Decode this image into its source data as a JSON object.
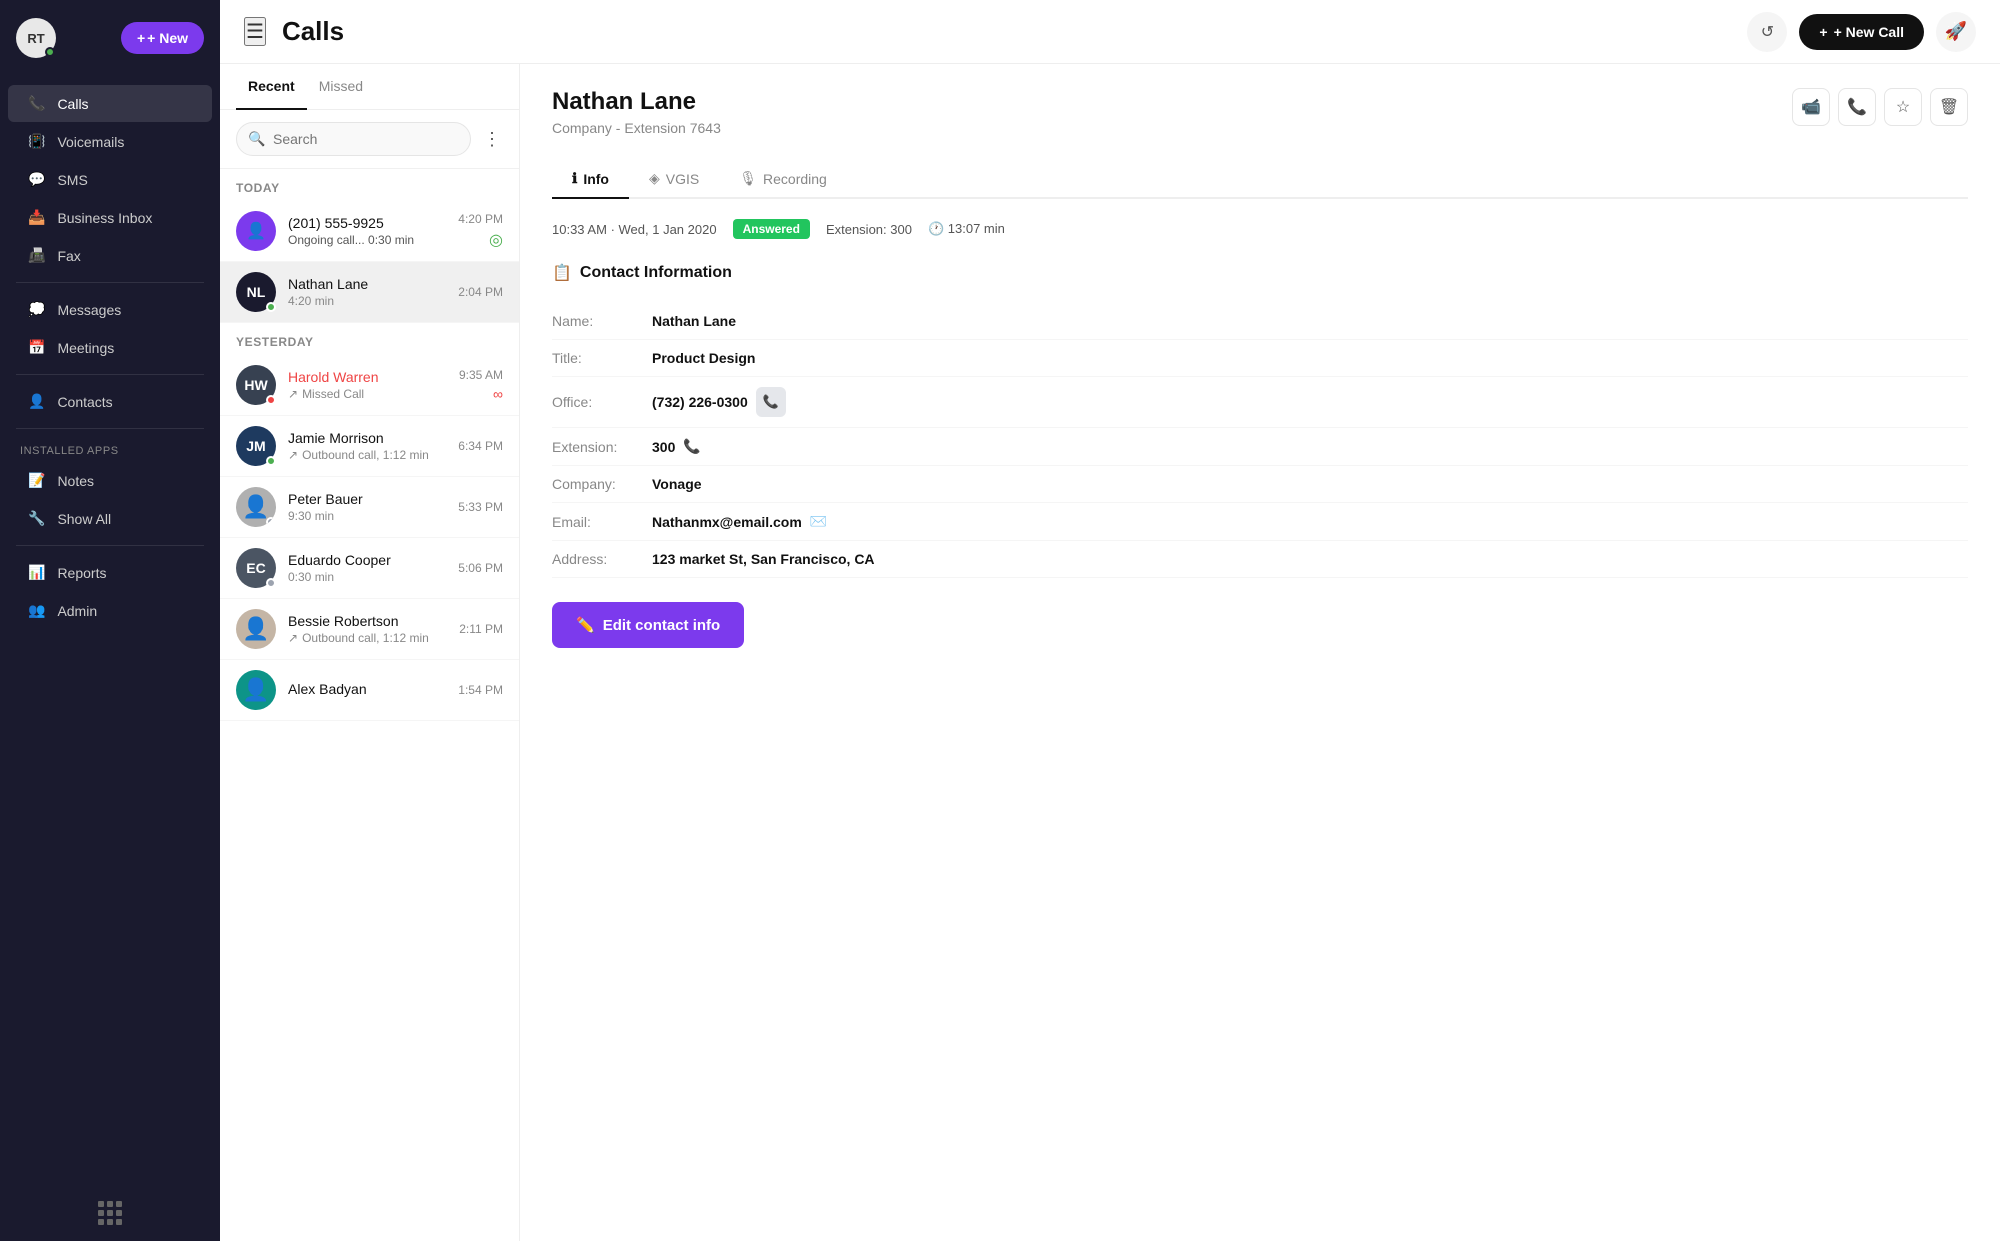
{
  "sidebar": {
    "avatar": "RT",
    "new_button": "+ New",
    "nav_items": [
      {
        "id": "calls",
        "label": "Calls",
        "active": true
      },
      {
        "id": "voicemails",
        "label": "Voicemails",
        "active": false
      },
      {
        "id": "sms",
        "label": "SMS",
        "active": false
      },
      {
        "id": "business-inbox",
        "label": "Business Inbox",
        "active": false
      },
      {
        "id": "fax",
        "label": "Fax",
        "active": false
      }
    ],
    "nav_items2": [
      {
        "id": "messages",
        "label": "Messages",
        "active": false
      },
      {
        "id": "meetings",
        "label": "Meetings",
        "active": false
      }
    ],
    "nav_items3": [
      {
        "id": "contacts",
        "label": "Contacts",
        "active": false
      }
    ],
    "installed_apps_label": "INSTALLED APPS",
    "installed_items": [
      {
        "id": "notes",
        "label": "Notes",
        "active": false
      },
      {
        "id": "show-all",
        "label": "Show All",
        "active": false
      }
    ],
    "bottom_items": [
      {
        "id": "reports",
        "label": "Reports",
        "active": false
      },
      {
        "id": "admin",
        "label": "Admin",
        "active": false
      }
    ]
  },
  "topbar": {
    "title": "Calls",
    "new_call_label": "+ New Call"
  },
  "calls_panel": {
    "tabs": [
      {
        "label": "Recent",
        "active": true
      },
      {
        "label": "Missed",
        "active": false
      }
    ],
    "search_placeholder": "Search",
    "sections": [
      {
        "label": "TODAY",
        "items": [
          {
            "id": "call-1",
            "name": "(201) 555-9925",
            "sub": "Ongoing call... 0:30 min",
            "time": "4:20 PM",
            "bg": "#7c3aed",
            "initials": "",
            "is_phone": true,
            "ongoing": true,
            "missed": false
          },
          {
            "id": "call-2",
            "name": "Nathan Lane",
            "sub": "4:20 min",
            "time": "2:04 PM",
            "bg": "#1a1a2e",
            "initials": "NL",
            "ongoing": false,
            "missed": false,
            "selected": true,
            "status": "green"
          }
        ]
      },
      {
        "label": "YESTERDAY",
        "items": [
          {
            "id": "call-3",
            "name": "Harold Warren",
            "sub": "Missed Call",
            "time": "9:35 AM",
            "bg": "#374151",
            "initials": "HW",
            "ongoing": false,
            "missed": true,
            "status": "red"
          },
          {
            "id": "call-4",
            "name": "Jamie Morrison",
            "sub": "Outbound call, 1:12 min",
            "time": "6:34 PM",
            "bg": "#1e3a5f",
            "initials": "JM",
            "ongoing": false,
            "missed": false,
            "status": "green",
            "outbound": true
          },
          {
            "id": "call-5",
            "name": "Peter Bauer",
            "sub": "9:30 min",
            "time": "5:33 PM",
            "bg": "#9ca3af",
            "initials": "",
            "has_photo": true,
            "ongoing": false,
            "missed": false,
            "status": "gray"
          },
          {
            "id": "call-6",
            "name": "Eduardo Cooper",
            "sub": "0:30 min",
            "time": "5:06 PM",
            "bg": "#374151",
            "initials": "EC",
            "ongoing": false,
            "missed": false,
            "status": "gray"
          },
          {
            "id": "call-7",
            "name": "Bessie Robertson",
            "sub": "Outbound call, 1:12 min",
            "time": "2:11 PM",
            "bg": "#9ca3af",
            "initials": "",
            "has_photo": true,
            "ongoing": false,
            "missed": false,
            "outbound": true
          },
          {
            "id": "call-8",
            "name": "Alex Badyan",
            "sub": "",
            "time": "1:54 PM",
            "bg": "#0d9488",
            "initials": "",
            "has_photo": true,
            "ongoing": false,
            "missed": false
          }
        ]
      }
    ]
  },
  "detail": {
    "name": "Nathan Lane",
    "sub": "Company  -  Extension 7643",
    "tabs": [
      {
        "label": "Info",
        "active": true,
        "icon": "ℹ️"
      },
      {
        "label": "VGIS",
        "active": false,
        "icon": "🔮"
      },
      {
        "label": "Recording",
        "active": false,
        "icon": "🎤"
      }
    ],
    "meta": {
      "time": "10:33 AM",
      "date": "Wed, 1 Jan 2020",
      "status": "Answered",
      "extension_label": "Extension:",
      "extension_value": "300",
      "duration_label": "13:07 min"
    },
    "contact_section_title": "Contact Information",
    "fields": [
      {
        "label": "Name:",
        "value": "Nathan Lane",
        "has_action": false
      },
      {
        "label": "Title:",
        "value": "Product  Design",
        "has_action": false
      },
      {
        "label": "Office:",
        "value": "(732) 226-0300",
        "has_action": true,
        "action_icon": "📞"
      },
      {
        "label": "Extension:",
        "value": "300",
        "has_action": true,
        "action_icon": "📞"
      },
      {
        "label": "Company:",
        "value": "Vonage",
        "has_action": false
      },
      {
        "label": "Email:",
        "value": "Nathanmx@email.com",
        "has_action": true,
        "action_icon": "✉️"
      },
      {
        "label": "Address:",
        "value": "123 market St, San Francisco, CA",
        "has_action": false
      }
    ],
    "edit_button": "Edit contact info"
  }
}
